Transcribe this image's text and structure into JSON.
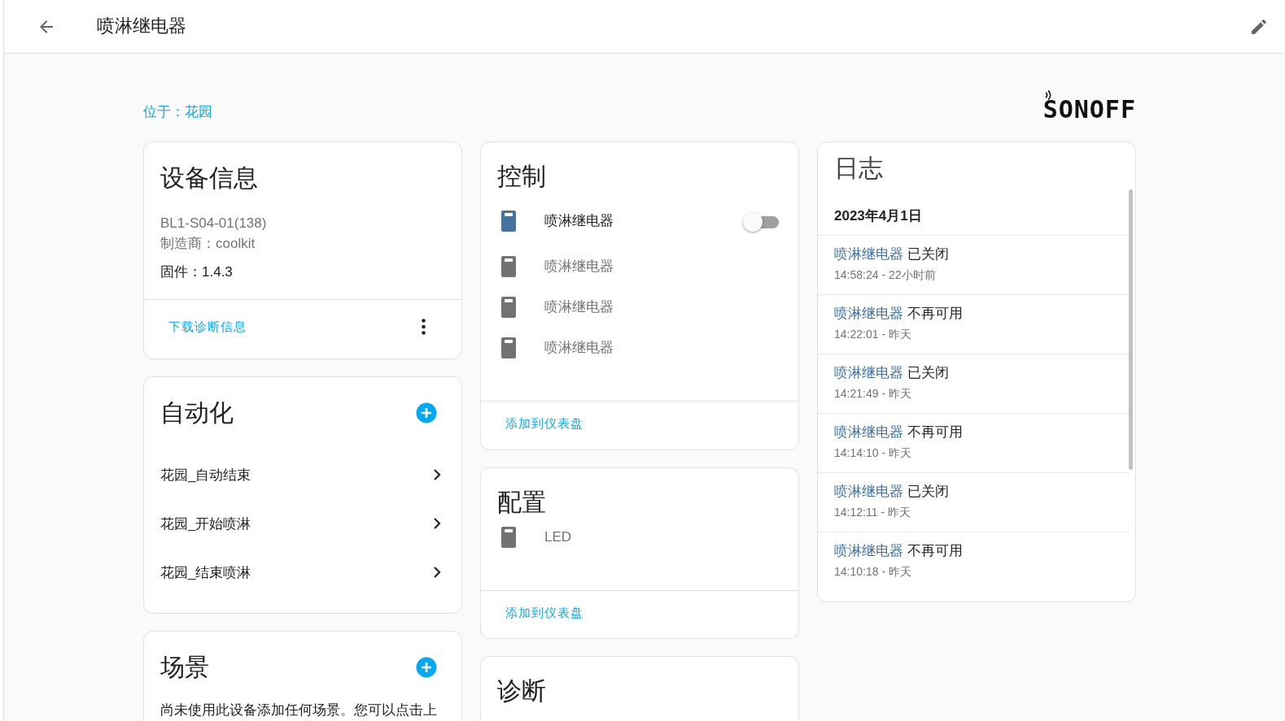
{
  "header": {
    "title": "喷淋继电器"
  },
  "area_link": "位于：花园",
  "logo": "SONOFF",
  "device_info": {
    "title": "设备信息",
    "model": "BL1-S04-01(138)",
    "manufacturer": "制造商：coolkit",
    "firmware": "固件：1.4.3",
    "action": "下载诊断信息"
  },
  "automations": {
    "title": "自动化",
    "items": [
      "花园_自动结束",
      "花园_开始喷淋",
      "花园_结束喷淋"
    ]
  },
  "scenes": {
    "title": "场景",
    "description": "尚未使用此设备添加任何场景。您可以点击上"
  },
  "controls": {
    "title": "控制",
    "entities": [
      {
        "name": "喷淋继电器",
        "disabled": false,
        "on": false
      },
      {
        "name": "喷淋继电器",
        "disabled": true
      },
      {
        "name": "喷淋继电器",
        "disabled": true
      },
      {
        "name": "喷淋继电器",
        "disabled": true
      }
    ],
    "action": "添加到仪表盘"
  },
  "configuration": {
    "title": "配置",
    "entities": [
      {
        "name": "LED",
        "disabled": true
      }
    ],
    "action": "添加到仪表盘"
  },
  "diagnostics": {
    "title": "诊断"
  },
  "logbook": {
    "title": "日志",
    "date": "2023年4月1日",
    "entries": [
      {
        "entity": "喷淋继电器",
        "message": "已关闭",
        "time": "14:58:24 - 22小时前"
      },
      {
        "entity": "喷淋继电器",
        "message": "不再可用",
        "time": "14:22:01 - 昨天"
      },
      {
        "entity": "喷淋继电器",
        "message": "已关闭",
        "time": "14:21:49 - 昨天"
      },
      {
        "entity": "喷淋继电器",
        "message": "不再可用",
        "time": "14:14:10 - 昨天"
      },
      {
        "entity": "喷淋继电器",
        "message": "已关闭",
        "time": "14:12:11 - 昨天"
      },
      {
        "entity": "喷淋继电器",
        "message": "不再可用",
        "time": "14:10:18 - 昨天"
      }
    ]
  }
}
